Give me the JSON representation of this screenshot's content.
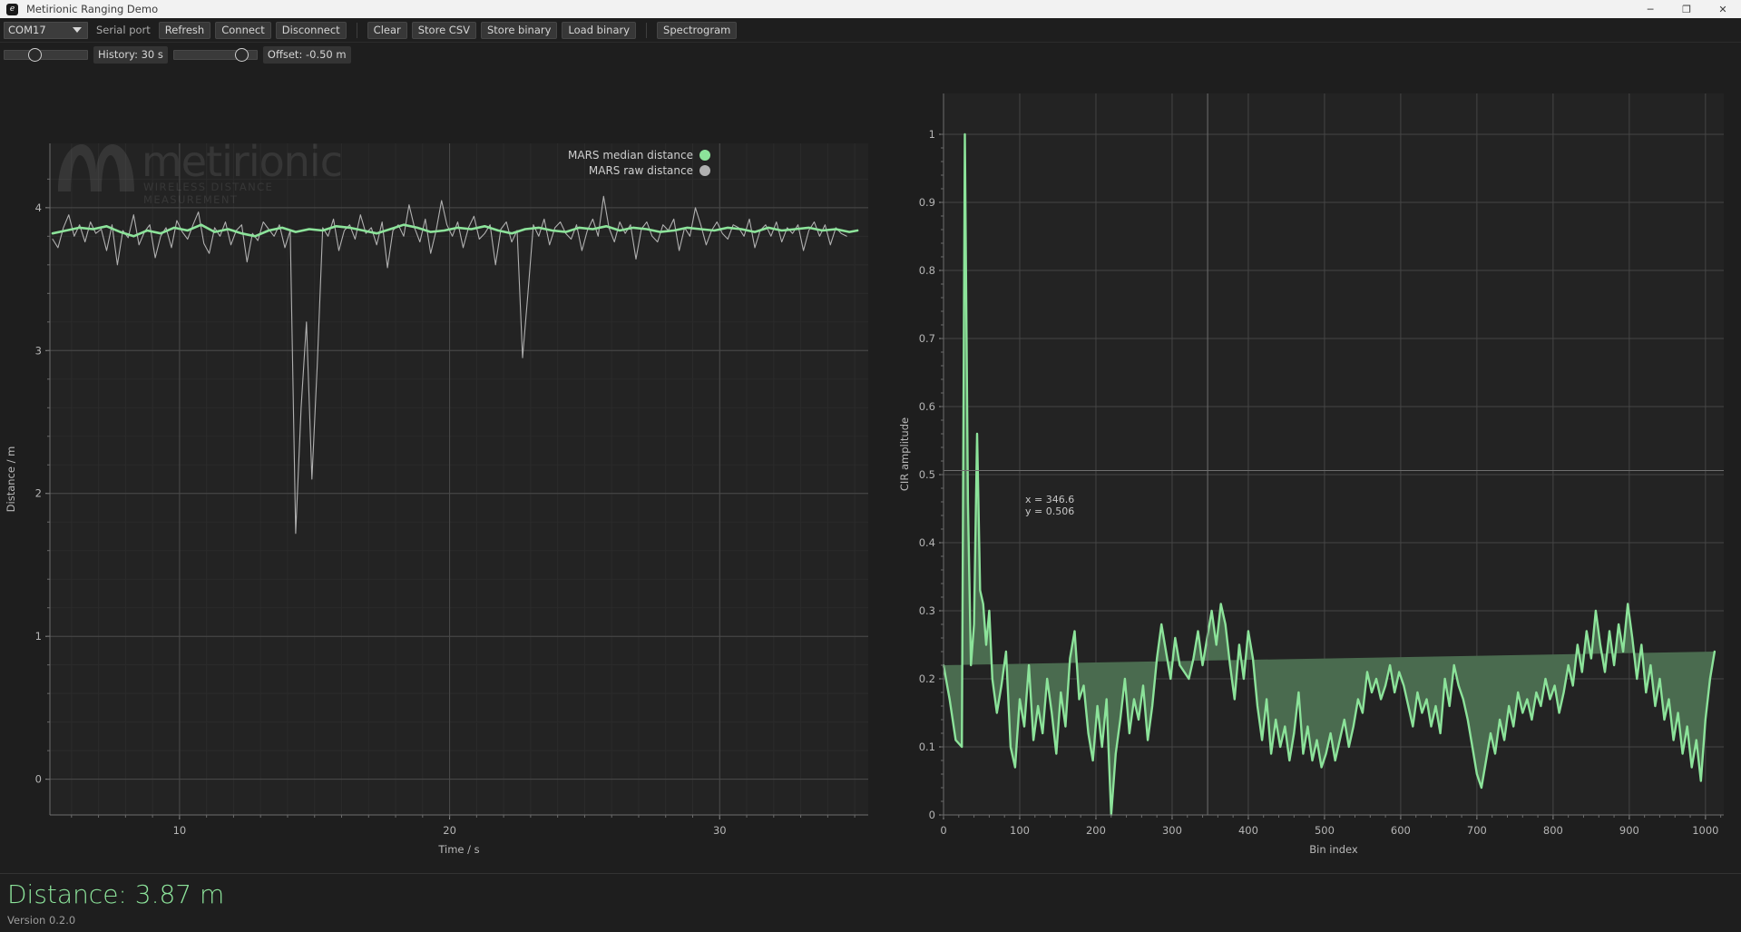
{
  "window": {
    "title": "Metirionic Ranging Demo",
    "icon": "app-icon",
    "minimize_label": "─",
    "maximize_label": "❐",
    "close_label": "✕"
  },
  "toolbar": {
    "port_value": "COM17",
    "port_label": "Serial port",
    "refresh_label": "Refresh",
    "connect_label": "Connect",
    "disconnect_label": "Disconnect",
    "clear_label": "Clear",
    "store_csv_label": "Store CSV",
    "store_binary_label": "Store binary",
    "load_binary_label": "Load binary",
    "spectrogram_label": "Spectrogram"
  },
  "controls": {
    "history_value": "History: 30 s",
    "offset_value": "Offset: -0.50 m"
  },
  "legend": {
    "median_label": "MARS median distance",
    "raw_label": "MARS raw distance",
    "median_color": "#8ce39a",
    "raw_color": "#b0b0b0"
  },
  "watermark": {
    "brand": "metirionic",
    "tagline": "WIRELESS DISTANCE MEASUREMENT"
  },
  "annotation": {
    "x_text": "x = 346.6",
    "y_text": "y = 0.506"
  },
  "status": {
    "distance": "Distance: 3.87 m",
    "version": "Version 0.2.0"
  },
  "chart_data": [
    {
      "type": "line",
      "name": "distance-timeseries",
      "title": "",
      "xlabel": "Time / s",
      "ylabel": "Distance / m",
      "xlim": [
        5.2,
        35.5
      ],
      "ylim": [
        -0.25,
        4.45
      ],
      "xticks": [
        10,
        20,
        30
      ],
      "yticks": [
        0,
        1,
        2,
        3,
        4
      ],
      "grid": true,
      "legend_position": "top-right",
      "series": [
        {
          "name": "MARS raw distance",
          "color": "#b0b0b0",
          "x": [
            5.3,
            5.5,
            5.7,
            5.9,
            6.1,
            6.3,
            6.5,
            6.7,
            6.9,
            7.1,
            7.3,
            7.5,
            7.7,
            7.9,
            8.1,
            8.3,
            8.5,
            8.7,
            8.9,
            9.1,
            9.3,
            9.5,
            9.7,
            9.9,
            10.1,
            10.3,
            10.5,
            10.7,
            10.9,
            11.1,
            11.3,
            11.5,
            11.7,
            11.9,
            12.1,
            12.3,
            12.5,
            12.7,
            12.9,
            13.1,
            13.3,
            13.5,
            13.7,
            13.9,
            14.1,
            14.3,
            14.5,
            14.7,
            14.9,
            15.1,
            15.3,
            15.5,
            15.7,
            15.9,
            16.1,
            16.3,
            16.5,
            16.7,
            16.9,
            17.1,
            17.3,
            17.5,
            17.7,
            17.9,
            18.1,
            18.3,
            18.5,
            18.7,
            18.9,
            19.1,
            19.3,
            19.5,
            19.7,
            19.9,
            20.1,
            20.3,
            20.5,
            20.7,
            20.9,
            21.1,
            21.3,
            21.5,
            21.7,
            21.9,
            22.1,
            22.3,
            22.5,
            22.7,
            22.9,
            23.1,
            23.3,
            23.5,
            23.7,
            23.9,
            24.1,
            24.3,
            24.5,
            24.7,
            24.9,
            25.1,
            25.3,
            25.5,
            25.7,
            25.9,
            26.1,
            26.3,
            26.5,
            26.7,
            26.9,
            27.1,
            27.3,
            27.5,
            27.7,
            27.9,
            28.1,
            28.3,
            28.5,
            28.7,
            28.9,
            29.1,
            29.3,
            29.5,
            29.7,
            29.9,
            30.1,
            30.3,
            30.5,
            30.7,
            30.9,
            31.1,
            31.3,
            31.5,
            31.7,
            31.9,
            32.1,
            32.3,
            32.5,
            32.7,
            32.9,
            33.1,
            33.3,
            33.5,
            33.7,
            33.9,
            34.1,
            34.3,
            34.5,
            34.7,
            34.9,
            35.1
          ],
          "y": [
            3.78,
            3.72,
            3.86,
            3.95,
            3.8,
            3.88,
            3.76,
            3.9,
            3.82,
            3.85,
            3.7,
            3.88,
            3.6,
            3.84,
            3.79,
            3.95,
            3.74,
            3.83,
            3.88,
            3.65,
            3.8,
            3.86,
            3.72,
            3.91,
            3.83,
            3.78,
            3.88,
            3.97,
            3.75,
            3.68,
            3.86,
            3.8,
            3.9,
            3.74,
            3.84,
            3.88,
            3.62,
            3.82,
            3.77,
            3.9,
            3.85,
            3.8,
            3.88,
            3.72,
            3.84,
            1.72,
            2.6,
            3.2,
            2.1,
            2.9,
            3.86,
            3.8,
            3.92,
            3.7,
            3.84,
            3.88,
            3.78,
            3.95,
            3.82,
            3.86,
            3.74,
            3.9,
            3.58,
            3.84,
            3.88,
            3.8,
            4.02,
            3.86,
            3.76,
            3.92,
            3.68,
            3.84,
            4.05,
            3.88,
            3.8,
            3.9,
            3.72,
            3.86,
            3.94,
            3.78,
            3.82,
            3.88,
            3.6,
            3.85,
            3.9,
            3.76,
            3.84,
            2.95,
            3.4,
            3.88,
            3.8,
            3.92,
            3.74,
            3.86,
            3.9,
            3.82,
            3.78,
            3.88,
            3.7,
            3.84,
            3.92,
            3.8,
            4.08,
            3.86,
            3.76,
            3.9,
            3.82,
            3.88,
            3.64,
            3.85,
            3.9,
            3.8,
            3.76,
            3.88,
            3.84,
            3.92,
            3.7,
            3.86,
            3.8,
            4.0,
            3.88,
            3.74,
            3.84,
            3.9,
            3.82,
            3.78,
            3.88,
            3.86,
            3.8,
            3.92,
            3.72,
            3.84,
            3.88,
            3.8,
            3.9,
            3.76,
            3.86,
            3.82,
            3.88,
            3.7,
            3.84,
            3.9,
            3.8,
            3.88,
            3.74,
            3.86,
            3.82,
            3.8
          ]
        },
        {
          "name": "MARS median distance",
          "color": "#8ce39a",
          "x": [
            5.3,
            5.8,
            6.3,
            6.8,
            7.3,
            7.8,
            8.3,
            8.8,
            9.3,
            9.8,
            10.3,
            10.8,
            11.3,
            11.8,
            12.3,
            12.8,
            13.3,
            13.8,
            14.3,
            14.8,
            15.3,
            15.8,
            16.3,
            16.8,
            17.3,
            17.8,
            18.3,
            18.8,
            19.3,
            19.8,
            20.3,
            20.8,
            21.3,
            21.8,
            22.3,
            22.8,
            23.3,
            23.8,
            24.3,
            24.8,
            25.3,
            25.8,
            26.3,
            26.8,
            27.3,
            27.8,
            28.3,
            28.8,
            29.3,
            29.8,
            30.3,
            30.8,
            31.3,
            31.8,
            32.3,
            32.8,
            33.3,
            33.8,
            34.3,
            34.8,
            35.1
          ],
          "y": [
            3.82,
            3.84,
            3.86,
            3.85,
            3.87,
            3.83,
            3.8,
            3.84,
            3.82,
            3.86,
            3.84,
            3.88,
            3.83,
            3.85,
            3.82,
            3.8,
            3.84,
            3.86,
            3.83,
            3.85,
            3.84,
            3.87,
            3.86,
            3.84,
            3.82,
            3.85,
            3.88,
            3.86,
            3.83,
            3.84,
            3.86,
            3.85,
            3.87,
            3.84,
            3.82,
            3.85,
            3.86,
            3.84,
            3.83,
            3.86,
            3.85,
            3.87,
            3.84,
            3.86,
            3.85,
            3.83,
            3.84,
            3.86,
            3.85,
            3.84,
            3.86,
            3.85,
            3.83,
            3.86,
            3.84,
            3.85,
            3.86,
            3.84,
            3.85,
            3.83,
            3.84
          ]
        }
      ]
    },
    {
      "type": "area",
      "name": "cir-amplitude",
      "title": "",
      "xlabel": "Bin index",
      "ylabel": "CIR amplitude",
      "xlim": [
        0,
        1024
      ],
      "ylim": [
        0,
        1.06
      ],
      "xticks": [
        0,
        100,
        200,
        300,
        400,
        500,
        600,
        700,
        800,
        900,
        1000
      ],
      "yticks": [
        0,
        0.1,
        0.2,
        0.3,
        0.4,
        0.5,
        0.6,
        0.7,
        0.8,
        0.9,
        1
      ],
      "grid": true,
      "line_color": "#8ce39a",
      "fill_color": "#4a6b4f",
      "marker": {
        "x": 346.6,
        "y": 0.506
      },
      "x": [
        0,
        8,
        16,
        24,
        28,
        32,
        36,
        40,
        44,
        48,
        52,
        56,
        60,
        64,
        70,
        76,
        82,
        88,
        94,
        100,
        106,
        112,
        118,
        124,
        130,
        136,
        142,
        148,
        154,
        160,
        166,
        172,
        178,
        184,
        190,
        196,
        202,
        208,
        214,
        220,
        226,
        232,
        238,
        244,
        250,
        256,
        262,
        268,
        274,
        280,
        286,
        292,
        298,
        304,
        310,
        316,
        322,
        328,
        334,
        340,
        346,
        352,
        358,
        364,
        370,
        376,
        382,
        388,
        394,
        400,
        406,
        412,
        418,
        424,
        430,
        436,
        442,
        448,
        454,
        460,
        466,
        472,
        478,
        484,
        490,
        496,
        502,
        508,
        514,
        520,
        526,
        532,
        538,
        544,
        550,
        556,
        562,
        568,
        574,
        580,
        586,
        592,
        598,
        604,
        610,
        616,
        622,
        628,
        634,
        640,
        646,
        652,
        658,
        664,
        670,
        676,
        682,
        688,
        694,
        700,
        706,
        712,
        718,
        724,
        730,
        736,
        742,
        748,
        754,
        760,
        766,
        772,
        778,
        784,
        790,
        796,
        802,
        808,
        814,
        820,
        826,
        832,
        838,
        844,
        850,
        856,
        862,
        868,
        874,
        880,
        886,
        892,
        898,
        904,
        910,
        916,
        922,
        928,
        934,
        940,
        946,
        952,
        958,
        964,
        970,
        976,
        982,
        988,
        994,
        1000,
        1006,
        1012,
        1018,
        1024
      ],
      "y": [
        0.22,
        0.17,
        0.11,
        0.1,
        1.0,
        0.46,
        0.22,
        0.28,
        0.56,
        0.33,
        0.31,
        0.25,
        0.3,
        0.2,
        0.15,
        0.19,
        0.24,
        0.1,
        0.07,
        0.17,
        0.13,
        0.22,
        0.11,
        0.16,
        0.12,
        0.2,
        0.15,
        0.09,
        0.18,
        0.13,
        0.23,
        0.27,
        0.17,
        0.19,
        0.12,
        0.08,
        0.16,
        0.1,
        0.17,
        0.0,
        0.09,
        0.14,
        0.2,
        0.12,
        0.17,
        0.14,
        0.19,
        0.11,
        0.16,
        0.23,
        0.28,
        0.24,
        0.2,
        0.26,
        0.22,
        0.21,
        0.2,
        0.23,
        0.27,
        0.22,
        0.26,
        0.3,
        0.25,
        0.31,
        0.28,
        0.22,
        0.17,
        0.25,
        0.2,
        0.27,
        0.23,
        0.16,
        0.11,
        0.17,
        0.09,
        0.14,
        0.1,
        0.13,
        0.08,
        0.12,
        0.18,
        0.09,
        0.13,
        0.08,
        0.11,
        0.07,
        0.09,
        0.12,
        0.08,
        0.11,
        0.14,
        0.1,
        0.13,
        0.17,
        0.15,
        0.21,
        0.18,
        0.2,
        0.17,
        0.19,
        0.22,
        0.18,
        0.21,
        0.19,
        0.16,
        0.13,
        0.18,
        0.15,
        0.17,
        0.13,
        0.16,
        0.12,
        0.2,
        0.16,
        0.22,
        0.19,
        0.17,
        0.14,
        0.1,
        0.06,
        0.04,
        0.08,
        0.12,
        0.09,
        0.14,
        0.11,
        0.16,
        0.13,
        0.18,
        0.15,
        0.17,
        0.14,
        0.18,
        0.16,
        0.2,
        0.17,
        0.19,
        0.15,
        0.18,
        0.22,
        0.19,
        0.25,
        0.21,
        0.27,
        0.23,
        0.3,
        0.25,
        0.21,
        0.27,
        0.22,
        0.28,
        0.24,
        0.31,
        0.26,
        0.2,
        0.25,
        0.18,
        0.22,
        0.16,
        0.2,
        0.14,
        0.17,
        0.11,
        0.15,
        0.09,
        0.13,
        0.07,
        0.11,
        0.05,
        0.14,
        0.2,
        0.24
      ]
    }
  ]
}
